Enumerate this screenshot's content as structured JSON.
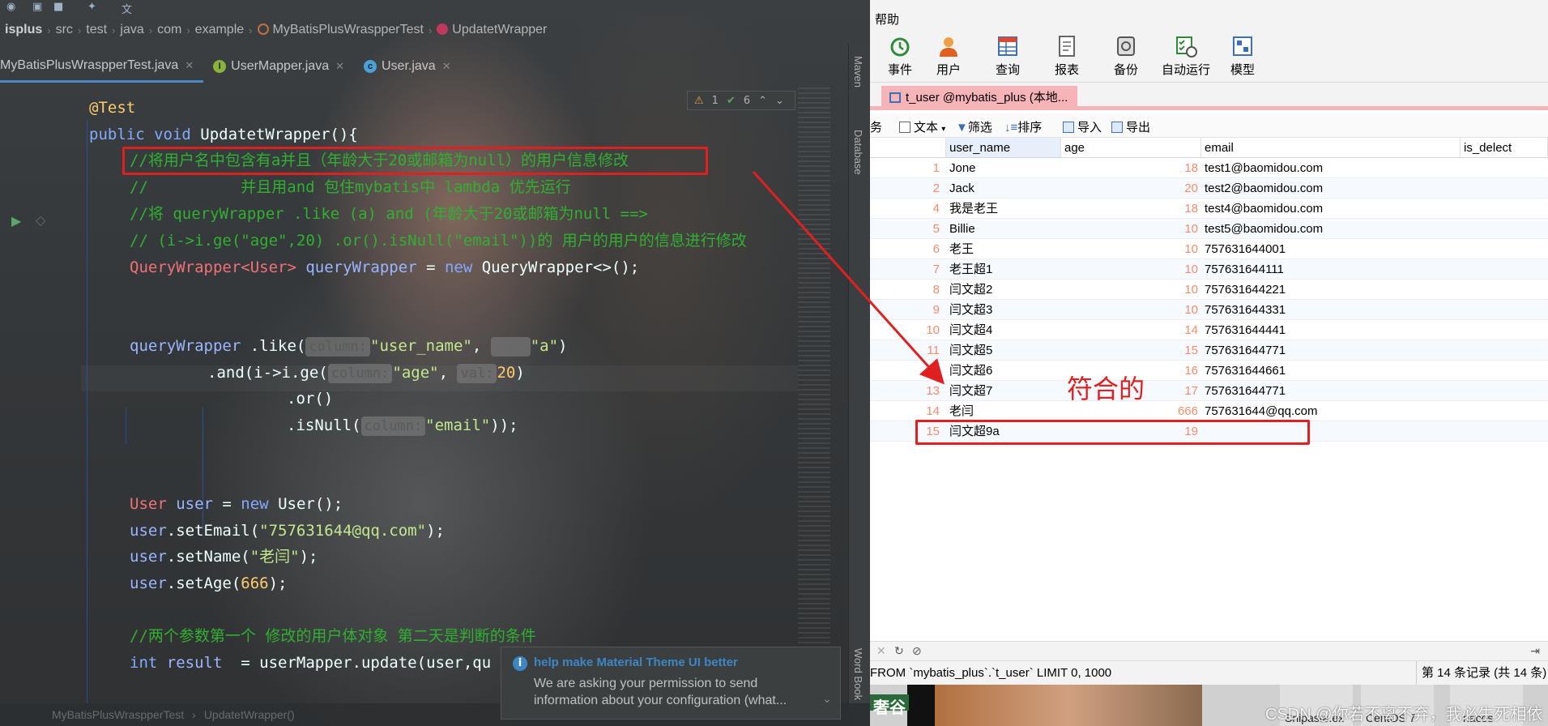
{
  "ide": {
    "breadcrumb": [
      "isplus",
      "src",
      "test",
      "java",
      "com",
      "example",
      "MyBatisPlusWraspperTest",
      "UpdatetWrapper"
    ],
    "tabs": [
      {
        "label": "MyBatisPlusWraspperTest.java",
        "active": true,
        "icon": "test-class-icon"
      },
      {
        "label": "UserMapper.java",
        "active": false,
        "icon": "interface-icon"
      },
      {
        "label": "User.java",
        "active": false,
        "icon": "class-icon"
      }
    ],
    "inspections": {
      "warnings": "1",
      "ok": "6"
    },
    "code": {
      "l1": "@Test",
      "l2_kw": "public void",
      "l2_rest": " UpdatetWrapper(){",
      "l3": "//将用户名中包含有a并且（年龄大于20或邮箱为null）的用户信息修改",
      "l4": "//          并且用and 包住mybatis中 lambda 优先运行",
      "l5": "//将 queryWrapper .like (a) and (年龄大于20或邮箱为null ==>",
      "l6": "// (i->i.ge(\"age\",20) .or().isNull(\"email\"))的 用户的用户的信息进行修改",
      "l7_type": "QueryWrapper<User>",
      "l7_var": "queryWrapper",
      "l7_op": " = ",
      "l7_new": "new",
      "l7_rest": " QueryWrapper<>();",
      "l8_var": "queryWrapper",
      "l8_call": " .like(",
      "l8_hint1": "column:",
      "l8_str1": "\"user_name\"",
      "l8_comma": ",",
      "l8_hint2": "val:",
      "l8_str2": "\"a\"",
      "l8_close": ")",
      "l9_call": ".and(i->i.ge(",
      "l9_hint1": "column:",
      "l9_str1": "\"age\"",
      "l9_comma": ",",
      "l9_hint2": "val:",
      "l9_num": "20",
      "l9_close": ")",
      "l10": ".or()",
      "l11_call": ".isNull(",
      "l11_hint": "column:",
      "l11_str": "\"email\"",
      "l11_close": "));",
      "l12_type": "User",
      "l12_var": " user",
      "l12_op": " = ",
      "l12_new": "new",
      "l12_rest": " User();",
      "l13_var": "user",
      "l13_call": ".setEmail(",
      "l13_str": "\"757631644@qq.com\"",
      "l13_close": ");",
      "l14_var": "user",
      "l14_call": ".setName(",
      "l14_str": "\"老闫\"",
      "l14_close": ");",
      "l15_var": "user",
      "l15_call": ".setAge(",
      "l15_num": "666",
      "l15_close": ");",
      "l16": "//两个参数第一个 修改的用户体对象 第二天是判断的条件",
      "l17_type": "int",
      "l17_var": " result",
      "l17_rest": "  = userMapper.update(user,qu"
    },
    "status_crumbs": [
      "MyBatisPlusWraspperTest",
      "UpdatetWrapper()"
    ],
    "side_tools": [
      "Maven",
      "Database",
      "Word Book"
    ],
    "notification": {
      "title": "help make Material Theme UI better",
      "body": "We are asking your permission to send information about your configuration (what..."
    }
  },
  "navicat": {
    "menu": "帮助",
    "toolbar": [
      {
        "label": "事件",
        "icon": "event-icon"
      },
      {
        "label": "用户",
        "icon": "user-icon"
      },
      {
        "label": "查询",
        "icon": "query-icon"
      },
      {
        "label": "报表",
        "icon": "report-icon"
      },
      {
        "label": "备份",
        "icon": "backup-icon"
      },
      {
        "label": "自动运行",
        "icon": "automation-icon"
      },
      {
        "label": "模型",
        "icon": "model-icon"
      }
    ],
    "tab_title": "t_user @mybatis_plus (本地...",
    "actions": {
      "left_cut": "务",
      "text": "文本",
      "filter": "筛选",
      "sort": "排序",
      "import": "导入",
      "export": "导出"
    },
    "columns": [
      "user_name",
      "age",
      "email",
      "is_delect"
    ],
    "rows": [
      {
        "id": "1",
        "user_name": "Jone",
        "age": "18",
        "email": "test1@baomidou.com"
      },
      {
        "id": "2",
        "user_name": "Jack",
        "age": "20",
        "email": "test2@baomidou.com"
      },
      {
        "id": "4",
        "user_name": "我是老王",
        "age": "18",
        "email": "test4@baomidou.com"
      },
      {
        "id": "5",
        "user_name": "Billie",
        "age": "10",
        "email": "test5@baomidou.com"
      },
      {
        "id": "6",
        "user_name": "老王",
        "age": "10",
        "email": "757631644001"
      },
      {
        "id": "7",
        "user_name": "老王超1",
        "age": "10",
        "email": "757631644111"
      },
      {
        "id": "8",
        "user_name": "闫文超2",
        "age": "10",
        "email": "757631644221"
      },
      {
        "id": "9",
        "user_name": "闫文超3",
        "age": "10",
        "email": "757631644331"
      },
      {
        "id": "10",
        "user_name": "闫文超4",
        "age": "14",
        "email": "757631644441"
      },
      {
        "id": "11",
        "user_name": "闫文超5",
        "age": "15",
        "email": "757631644771"
      },
      {
        "id": "12",
        "user_name": "闫文超6",
        "age": "16",
        "email": "757631644661"
      },
      {
        "id": "13",
        "user_name": "闫文超7",
        "age": "17",
        "email": "757631644771"
      },
      {
        "id": "14",
        "user_name": "老闫",
        "age": "666",
        "email": "757631644@qq.com"
      },
      {
        "id": "15",
        "user_name": "闫文超9a",
        "age": "19",
        "email": ""
      }
    ],
    "annotation": "符合的",
    "sql": "FROM `mybatis_plus`.`t_user` LIMIT 0, 1000",
    "record_count": "第 14 条记录 (共 14 条)",
    "taskbar": {
      "snipaste": "Snipaste.ex",
      "centos": "CentOS 7",
      "nacos": "nacos",
      "corner": "奢谷",
      "watermark": "CSDN @你若不离不弃，我必生死相依"
    }
  },
  "colors": {
    "annotation_red": "#e02020",
    "tab_pink": "#f7b4b8",
    "comment_green": "#30b030",
    "info_blue": "#3d86c6"
  }
}
